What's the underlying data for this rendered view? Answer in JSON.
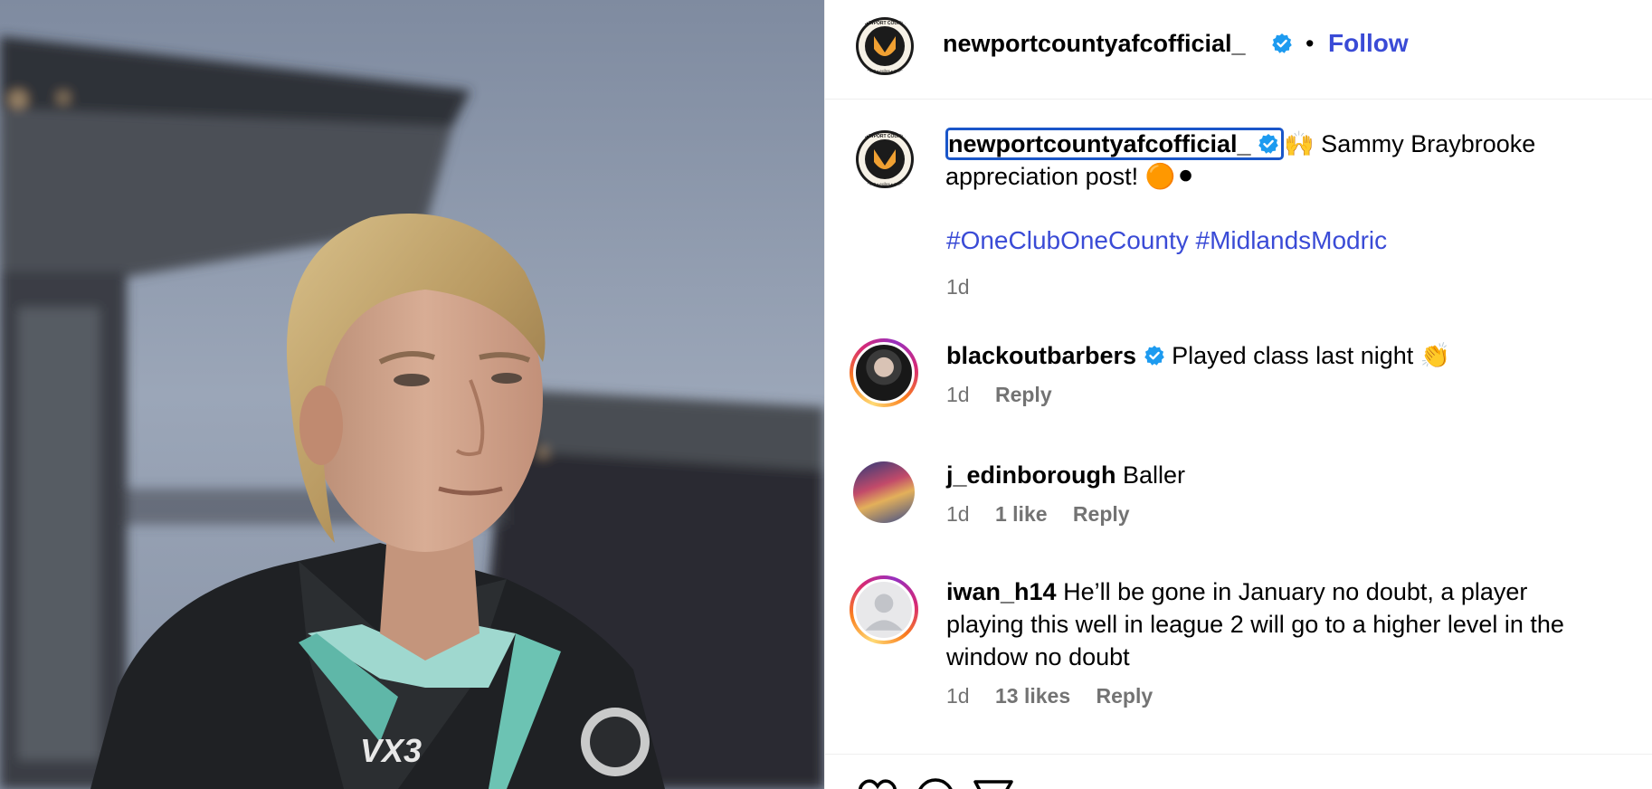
{
  "post": {
    "account": "newportcountyafcofficial_",
    "follow_label": "Follow",
    "dot": "•",
    "logo_text_top": "NEWPORT COUNTY AFC",
    "logo_text_bottom": "1912 • exiles • 1989",
    "caption_text_1": "🙌 Sammy Braybrooke",
    "caption_text_2": "appreciation post! 🟠⚫",
    "hashtags": [
      "#OneClubOneCounty",
      "#MidlandsModric"
    ],
    "time": "1d",
    "kit_sponsor": "VX3"
  },
  "comments": [
    {
      "username": "blackoutbarbers",
      "verified": true,
      "text": "Played class last night 👏",
      "time": "1d",
      "likes": "",
      "reply": "Reply"
    },
    {
      "username": "j_edinborough",
      "verified": false,
      "text": "Baller",
      "time": "1d",
      "likes": "1 like",
      "reply": "Reply"
    },
    {
      "username": "iwan_h14",
      "verified": false,
      "text_1": "He’ll be gone in January no doubt, a player",
      "text_2": "playing this well in league 2 will go to a higher level in the",
      "text_3": "window no doubt",
      "time": "1d",
      "likes": "13 likes",
      "reply": "Reply"
    }
  ],
  "colors": {
    "link": "#3a4bd6",
    "verified": "#1d9bf0",
    "muted": "#737373",
    "focus": "#1a56c9"
  },
  "icons": [
    "verified-badge-icon",
    "heart-icon",
    "comment-icon",
    "share-icon",
    "default-avatar-icon"
  ]
}
